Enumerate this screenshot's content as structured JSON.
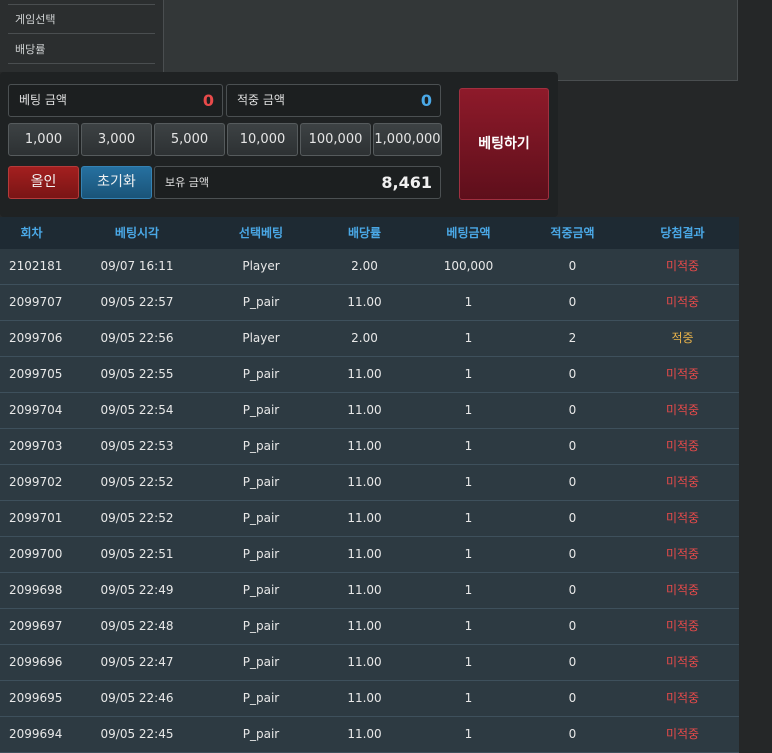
{
  "menu": {
    "items": [
      {
        "label": "게임선택"
      },
      {
        "label": "배당률"
      }
    ]
  },
  "betting": {
    "bet_amount_label": "베팅 금액",
    "bet_amount_value": "0",
    "win_amount_label": "적중 금액",
    "win_amount_value": "0",
    "chips": [
      "1,000",
      "3,000",
      "5,000",
      "10,000",
      "100,000",
      "1,000,000"
    ],
    "allin_label": "올인",
    "reset_label": "초기화",
    "balance_label": "보유 금액",
    "balance_value": "8,461",
    "place_bet_label": "베팅하기"
  },
  "colors": {
    "bet_value": "#e84a4a",
    "win_value": "#4aa8e6",
    "allin_bg": "#8e1a1a",
    "reset_bg": "#1f5f86",
    "header_text": "#4aa8e6",
    "miss": "#e84a4a",
    "hit": "#e8b24a"
  },
  "history": {
    "columns": [
      "회차",
      "베팅시각",
      "선택베팅",
      "배당률",
      "베팅금액",
      "적중금액",
      "당첨결과"
    ],
    "rows": [
      {
        "round": "2102181",
        "time": "09/07 16:11",
        "pick": "Player",
        "odds": "2.00",
        "bet": "100,000",
        "win": "0",
        "result": "미적중"
      },
      {
        "round": "2099707",
        "time": "09/05 22:57",
        "pick": "P_pair",
        "odds": "11.00",
        "bet": "1",
        "win": "0",
        "result": "미적중"
      },
      {
        "round": "2099706",
        "time": "09/05 22:56",
        "pick": "Player",
        "odds": "2.00",
        "bet": "1",
        "win": "2",
        "result": "적중"
      },
      {
        "round": "2099705",
        "time": "09/05 22:55",
        "pick": "P_pair",
        "odds": "11.00",
        "bet": "1",
        "win": "0",
        "result": "미적중"
      },
      {
        "round": "2099704",
        "time": "09/05 22:54",
        "pick": "P_pair",
        "odds": "11.00",
        "bet": "1",
        "win": "0",
        "result": "미적중"
      },
      {
        "round": "2099703",
        "time": "09/05 22:53",
        "pick": "P_pair",
        "odds": "11.00",
        "bet": "1",
        "win": "0",
        "result": "미적중"
      },
      {
        "round": "2099702",
        "time": "09/05 22:52",
        "pick": "P_pair",
        "odds": "11.00",
        "bet": "1",
        "win": "0",
        "result": "미적중"
      },
      {
        "round": "2099701",
        "time": "09/05 22:52",
        "pick": "P_pair",
        "odds": "11.00",
        "bet": "1",
        "win": "0",
        "result": "미적중"
      },
      {
        "round": "2099700",
        "time": "09/05 22:51",
        "pick": "P_pair",
        "odds": "11.00",
        "bet": "1",
        "win": "0",
        "result": "미적중"
      },
      {
        "round": "2099698",
        "time": "09/05 22:49",
        "pick": "P_pair",
        "odds": "11.00",
        "bet": "1",
        "win": "0",
        "result": "미적중"
      },
      {
        "round": "2099697",
        "time": "09/05 22:48",
        "pick": "P_pair",
        "odds": "11.00",
        "bet": "1",
        "win": "0",
        "result": "미적중"
      },
      {
        "round": "2099696",
        "time": "09/05 22:47",
        "pick": "P_pair",
        "odds": "11.00",
        "bet": "1",
        "win": "0",
        "result": "미적중"
      },
      {
        "round": "2099695",
        "time": "09/05 22:46",
        "pick": "P_pair",
        "odds": "11.00",
        "bet": "1",
        "win": "0",
        "result": "미적중"
      },
      {
        "round": "2099694",
        "time": "09/05 22:45",
        "pick": "P_pair",
        "odds": "11.00",
        "bet": "1",
        "win": "0",
        "result": "미적중"
      }
    ]
  }
}
